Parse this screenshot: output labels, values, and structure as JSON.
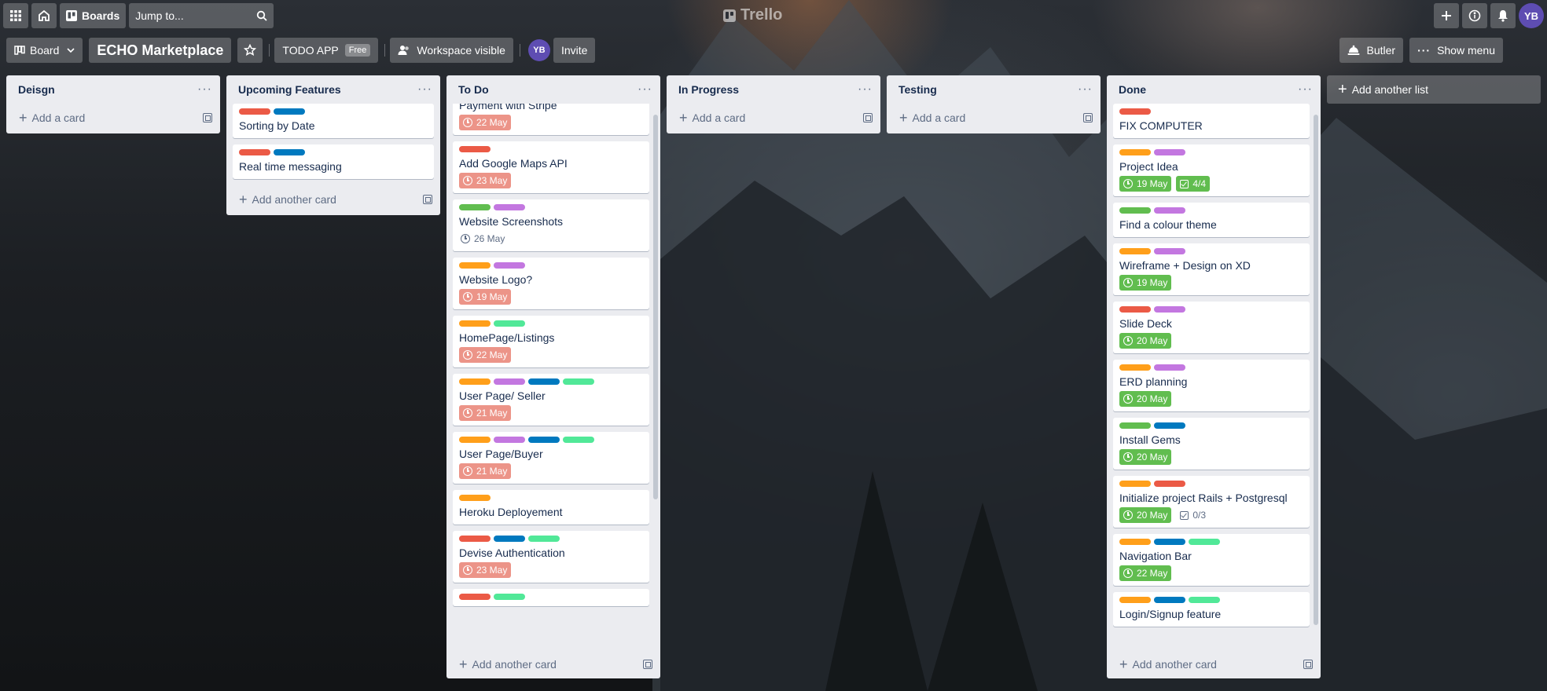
{
  "colors": {
    "label_red": "#eb5a46",
    "label_blue": "#0079bf",
    "label_green": "#61bd4f",
    "label_purple": "#c377e0",
    "label_orange": "#ff9f1a",
    "label_lime": "#51e898",
    "due_overdue": "#ec9488",
    "due_complete": "#61bd4f"
  },
  "topbar": {
    "apps_icon": "grid-icon",
    "home_icon": "home-icon",
    "boards_label": "Boards",
    "search_placeholder": "Jump to...",
    "logo_text": "Trello",
    "avatar_initials": "YB"
  },
  "boardbar": {
    "view_label": "Board",
    "title": "ECHO Marketplace",
    "workspace_label": "TODO APP",
    "plan_badge": "Free",
    "visibility_label": "Workspace visible",
    "member_initials": "YB",
    "invite_label": "Invite",
    "butler_label": "Butler",
    "show_menu_label": "Show menu"
  },
  "add_list_label": "Add another list",
  "lists": [
    {
      "title": "Deisgn",
      "add_label": "Add a card",
      "cards": []
    },
    {
      "title": "Upcoming Features",
      "add_label": "Add another card",
      "cards": [
        {
          "title": "Sorting by Date",
          "labels": [
            "red",
            "blue"
          ]
        },
        {
          "title": "Real time messaging",
          "labels": [
            "red",
            "blue"
          ]
        }
      ]
    },
    {
      "title": "To Do",
      "add_label": "Add another card",
      "scrollbar": true,
      "cards": [
        {
          "title": "Payment with Stripe",
          "labels": [],
          "due": {
            "text": "22 May",
            "status": "overdue"
          },
          "clipped_top": true
        },
        {
          "title": "Add Google Maps API",
          "labels": [
            "red"
          ],
          "due": {
            "text": "23 May",
            "status": "overdue"
          }
        },
        {
          "title": "Website Screenshots",
          "labels": [
            "green",
            "purple"
          ],
          "due": {
            "text": "26 May",
            "status": "plain"
          }
        },
        {
          "title": "Website Logo?",
          "labels": [
            "orange",
            "purple"
          ],
          "due": {
            "text": "19 May",
            "status": "overdue"
          }
        },
        {
          "title": "HomePage/Listings",
          "labels": [
            "orange",
            "lime"
          ],
          "due": {
            "text": "22 May",
            "status": "overdue"
          }
        },
        {
          "title": "User Page/ Seller",
          "labels": [
            "orange",
            "purple",
            "blue",
            "lime"
          ],
          "due": {
            "text": "21 May",
            "status": "overdue"
          }
        },
        {
          "title": "User Page/Buyer",
          "labels": [
            "orange",
            "purple",
            "blue",
            "lime"
          ],
          "due": {
            "text": "21 May",
            "status": "overdue"
          }
        },
        {
          "title": "Heroku Deployement",
          "labels": [
            "orange"
          ]
        },
        {
          "title": "Devise Authentication",
          "labels": [
            "red",
            "blue",
            "lime"
          ],
          "due": {
            "text": "23 May",
            "status": "overdue"
          }
        },
        {
          "title": "",
          "labels": [
            "red",
            "lime"
          ]
        }
      ]
    },
    {
      "title": "In Progress",
      "add_label": "Add a card",
      "cards": []
    },
    {
      "title": "Testing",
      "add_label": "Add a card",
      "cards": []
    },
    {
      "title": "Done",
      "add_label": "Add another card",
      "scrollbar": true,
      "cards": [
        {
          "title": "FIX COMPUTER",
          "labels": [
            "red"
          ]
        },
        {
          "title": "Project Idea",
          "labels": [
            "orange",
            "purple"
          ],
          "due": {
            "text": "19 May",
            "status": "complete"
          },
          "checklist": {
            "text": "4/4",
            "complete": true
          }
        },
        {
          "title": "Find a colour theme",
          "labels": [
            "green",
            "purple"
          ]
        },
        {
          "title": "Wireframe + Design on XD",
          "labels": [
            "orange",
            "purple"
          ],
          "due": {
            "text": "19 May",
            "status": "complete"
          }
        },
        {
          "title": "Slide Deck",
          "labels": [
            "red",
            "purple"
          ],
          "due": {
            "text": "20 May",
            "status": "complete"
          }
        },
        {
          "title": "ERD planning",
          "labels": [
            "orange",
            "purple"
          ],
          "due": {
            "text": "20 May",
            "status": "complete"
          }
        },
        {
          "title": "Install Gems",
          "labels": [
            "green",
            "blue"
          ],
          "due": {
            "text": "20 May",
            "status": "complete"
          }
        },
        {
          "title": "Initialize project Rails + Postgresql",
          "labels": [
            "orange",
            "red"
          ],
          "due": {
            "text": "20 May",
            "status": "complete"
          },
          "checklist": {
            "text": "0/3",
            "complete": false
          }
        },
        {
          "title": "Navigation Bar",
          "labels": [
            "orange",
            "blue",
            "lime"
          ],
          "due": {
            "text": "22 May",
            "status": "complete"
          }
        },
        {
          "title": "Login/Signup feature",
          "labels": [
            "orange",
            "blue",
            "lime"
          ]
        }
      ]
    }
  ]
}
